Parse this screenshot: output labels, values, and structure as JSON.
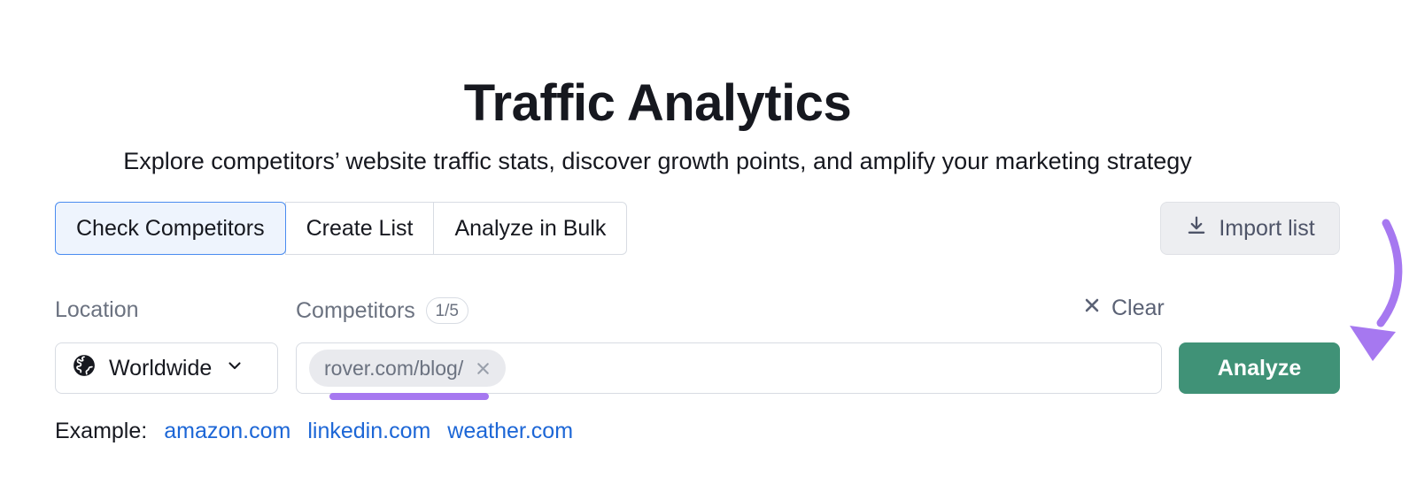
{
  "header": {
    "title": "Traffic Analytics",
    "subtitle": "Explore competitors’ website traffic stats, discover growth points, and amplify your marketing strategy"
  },
  "tabs": [
    {
      "label": "Check Competitors",
      "active": true
    },
    {
      "label": "Create List",
      "active": false
    },
    {
      "label": "Analyze in Bulk",
      "active": false
    }
  ],
  "toolbar": {
    "import_label": "Import list",
    "import_icon": "download-icon"
  },
  "fields": {
    "location_label": "Location",
    "location_value": "Worldwide",
    "location_icon": "globe-icon",
    "location_chevron": "chevron-down-icon",
    "competitors_label": "Competitors",
    "competitors_count": "1/5",
    "clear_label": "Clear",
    "clear_icon": "close-x-icon",
    "chips": [
      {
        "label": "rover.com/blog/",
        "remove_icon": "close-x-icon"
      }
    ]
  },
  "actions": {
    "analyze_label": "Analyze"
  },
  "examples": {
    "label": "Example:",
    "links": [
      "amazon.com",
      "linkedin.com",
      "weather.com"
    ]
  },
  "colors": {
    "accent_green": "#409277",
    "link_blue": "#1c66d6",
    "tab_active_bg": "#eef4fd",
    "tab_active_border": "#4a8cf0",
    "annotation_purple": "#a678f0",
    "chip_bg": "#e9eaee",
    "text_dark": "#16181f",
    "text_muted": "#6b7280"
  }
}
